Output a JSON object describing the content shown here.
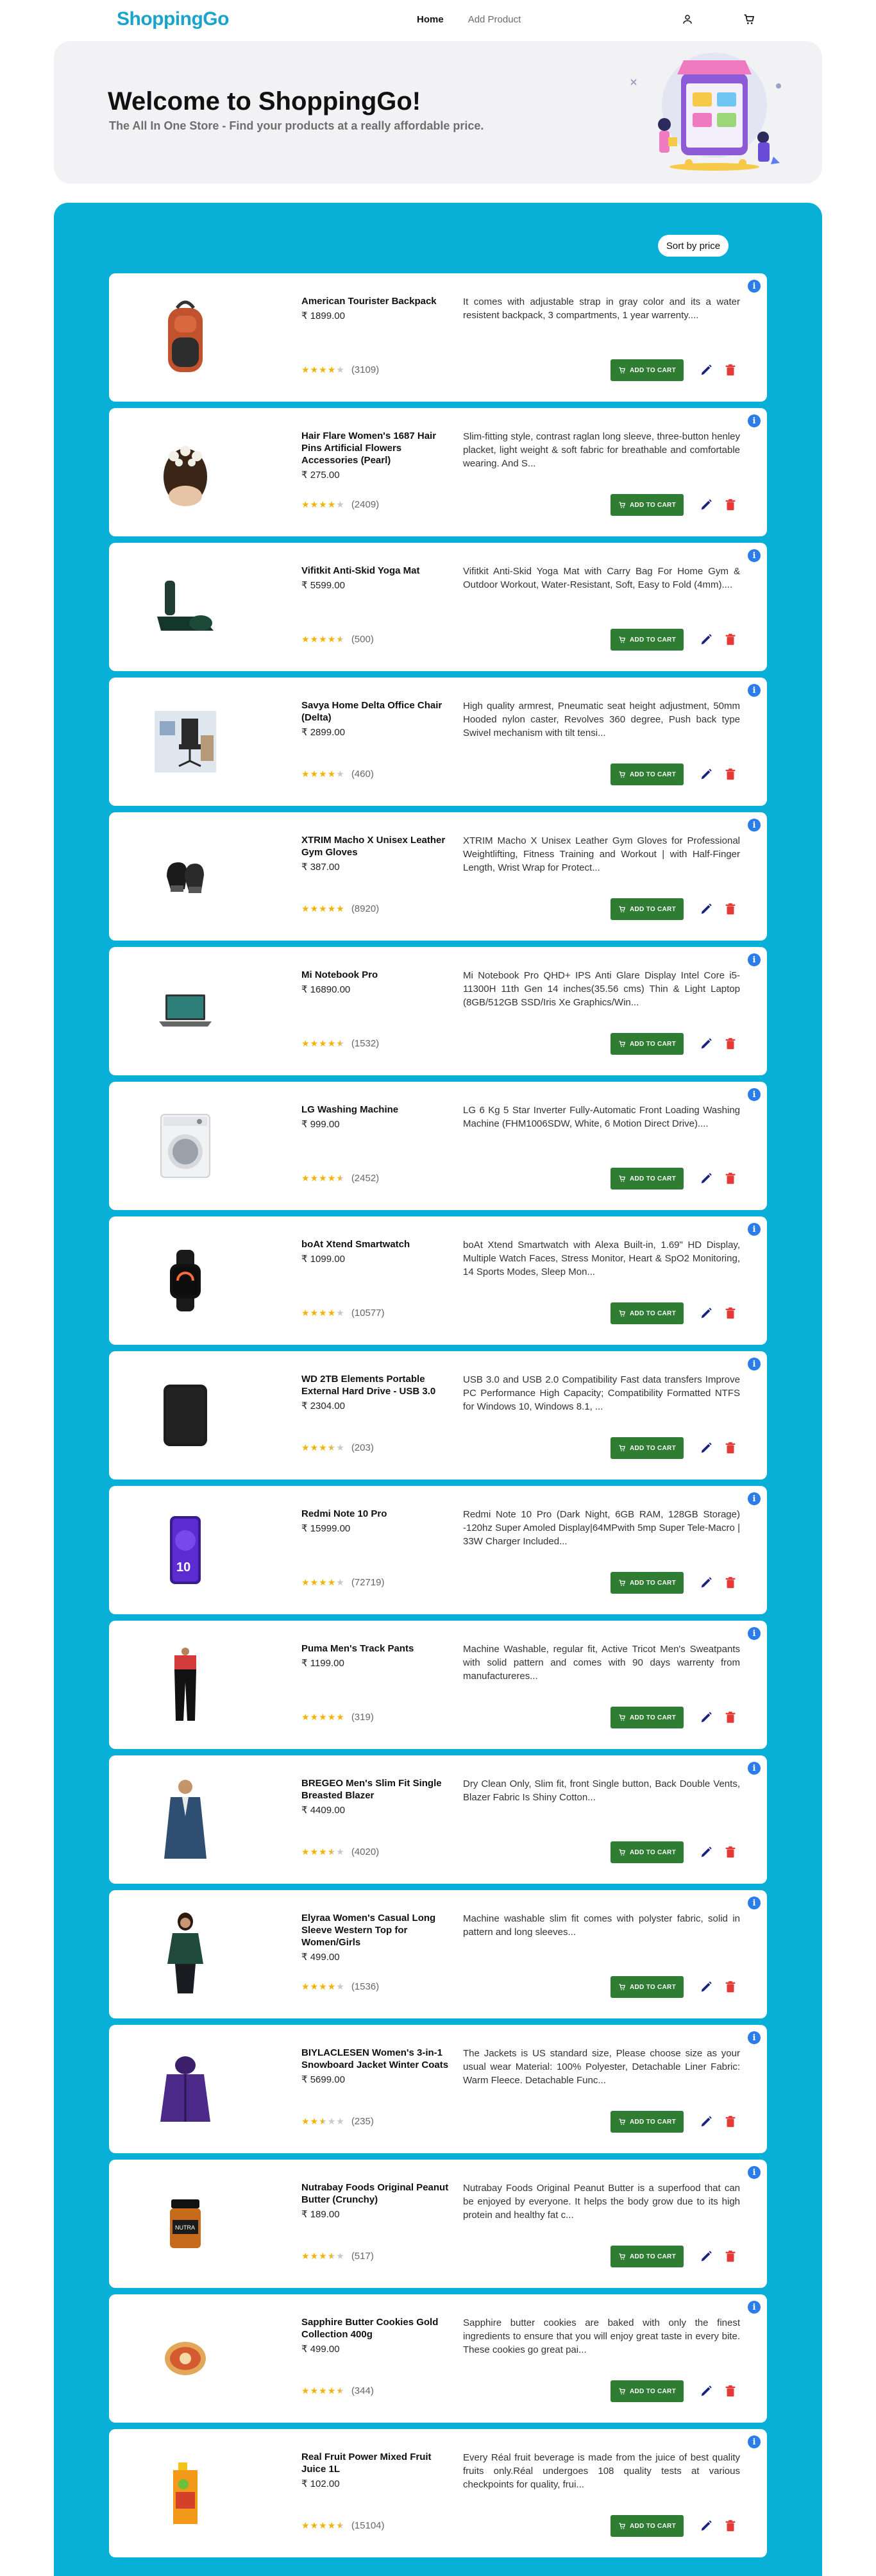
{
  "brand": "ShoppingGo",
  "nav": {
    "home": "Home",
    "add_product": "Add Product",
    "icons": [
      "user-icon",
      "cart-icon"
    ]
  },
  "hero": {
    "title": "Welcome to ShoppingGo!",
    "subtitle": "The All In One Store - Find your products at a really affordable price."
  },
  "sort_label": "Sort by price",
  "actions": {
    "add_to_cart": "ADD TO CART"
  },
  "colors": {
    "brand": "#1aa3cc",
    "panel": "#08afd6",
    "cart_button": "#2e7d32",
    "delete": "#e53935",
    "edit": "#1a237e",
    "info": "#2b7de9",
    "star": "#f5b301"
  },
  "products": [
    {
      "title": "American Tourister Backpack",
      "price": "₹ 1899.00",
      "desc": "It comes with adjustable strap in gray color and its a water resistent backpack, 3 compartments, 1 year warrenty....",
      "rating": 4,
      "count": "(3109)",
      "icon": "backpack"
    },
    {
      "title": "Hair Flare Women's 1687 Hair Pins Artificial Flowers Accessories (Pearl)",
      "price": "₹ 275.00",
      "desc": "Slim-fitting style, contrast raglan long sleeve, three-button henley placket, light weight & soft fabric for breathable and comfortable wearing. And S...",
      "rating": 4,
      "count": "(2409)",
      "icon": "hairpin"
    },
    {
      "title": "Vifitkit Anti-Skid Yoga Mat",
      "price": "₹ 5599.00",
      "desc": "Vifitkit Anti-Skid Yoga Mat with Carry Bag For Home Gym & Outdoor Workout, Water-Resistant, Soft, Easy to Fold (4mm)....",
      "rating": 4.5,
      "count": "(500)",
      "icon": "yoga-mat"
    },
    {
      "title": "Savya Home Delta Office Chair (Delta)",
      "price": "₹ 2899.00",
      "desc": "High quality armrest, Pneumatic seat height adjustment, 50mm Hooded nylon caster, Revolves 360 degree, Push back type Swivel mechanism with tilt tensi...",
      "rating": 4,
      "count": "(460)",
      "icon": "chair"
    },
    {
      "title": "XTRIM Macho X Unisex Leather Gym Gloves",
      "price": "₹ 387.00",
      "desc": "XTRIM Macho X Unisex Leather Gym Gloves for Professional Weightlifting, Fitness Training and Workout | with Half-Finger Length, Wrist Wrap for Protect...",
      "rating": 5,
      "count": "(8920)",
      "icon": "gloves"
    },
    {
      "title": "Mi Notebook Pro",
      "price": "₹ 16890.00",
      "desc": "Mi Notebook Pro QHD+ IPS Anti Glare Display Intel Core i5-11300H 11th Gen 14 inches(35.56 cms) Thin & Light Laptop (8GB/512GB SSD/Iris Xe Graphics/Win...",
      "rating": 4.5,
      "count": "(1532)",
      "icon": "laptop"
    },
    {
      "title": "LG Washing Machine",
      "price": "₹ 999.00",
      "desc": "LG 6 Kg 5 Star Inverter Fully-Automatic Front Loading Washing Machine (FHM1006SDW, White, 6 Motion Direct Drive)....",
      "rating": 4.5,
      "count": "(2452)",
      "icon": "washing-machine"
    },
    {
      "title": "boAt Xtend Smartwatch",
      "price": "₹ 1099.00",
      "desc": "boAt Xtend Smartwatch with Alexa Built-in, 1.69\" HD Display, Multiple Watch Faces, Stress Monitor, Heart & SpO2 Monitoring, 14 Sports Modes, Sleep Mon...",
      "rating": 4,
      "count": "(10577)",
      "icon": "smartwatch"
    },
    {
      "title": "WD 2TB Elements Portable External Hard Drive - USB 3.0",
      "price": "₹ 2304.00",
      "desc": "USB 3.0 and USB 2.0 Compatibility Fast data transfers Improve PC Performance High Capacity; Compatibility Formatted NTFS for Windows 10, Windows 8.1, ...",
      "rating": 3.5,
      "count": "(203)",
      "icon": "hard-drive"
    },
    {
      "title": "Redmi Note 10 Pro",
      "price": "₹ 15999.00",
      "desc": "Redmi Note 10 Pro (Dark Night, 6GB RAM, 128GB Storage) -120hz Super Amoled Display|64MPwith 5mp Super Tele-Macro | 33W Charger Included...",
      "rating": 4,
      "count": "(72719)",
      "icon": "phone"
    },
    {
      "title": "Puma Men's Track Pants",
      "price": "₹ 1199.00",
      "desc": "Machine Washable, regular fit, Active Tricot Men's Sweatpants with solid pattern and comes with 90 days warrenty from manufactureres...",
      "rating": 5,
      "count": "(319)",
      "icon": "track-pants"
    },
    {
      "title": "BREGEO Men's Slim Fit Single Breasted Blazer",
      "price": "₹ 4409.00",
      "desc": "Dry Clean Only, Slim fit, front Single button, Back Double Vents, Blazer Fabric Is Shiny Cotton...",
      "rating": 3.5,
      "count": "(4020)",
      "icon": "blazer"
    },
    {
      "title": "Elyraa Women's Casual Long Sleeve Western Top for Women/Girls",
      "price": "₹ 499.00",
      "desc": "Machine washable slim fit comes with polyster fabric, solid in pattern and long sleeves...",
      "rating": 4,
      "count": "(1536)",
      "icon": "top"
    },
    {
      "title": "BIYLACLESEN Women's 3-in-1 Snowboard Jacket Winter Coats",
      "price": "₹ 5699.00",
      "desc": "The Jackets is US standard size, Please choose size as your usual wear Material: 100% Polyester, Detachable Liner Fabric: Warm Fleece. Detachable Func...",
      "rating": 2.5,
      "count": "(235)",
      "icon": "jacket"
    },
    {
      "title": "Nutrabay Foods Original Peanut Butter (Crunchy)",
      "price": "₹ 189.00",
      "desc": "Nutrabay Foods Original Peanut Butter is a superfood that can be enjoyed by everyone. It helps the body grow due to its high protein and healthy fat c...",
      "rating": 3.5,
      "count": "(517)",
      "icon": "peanut-butter"
    },
    {
      "title": "Sapphire Butter Cookies Gold Collection 400g",
      "price": "₹ 499.00",
      "desc": "Sapphire butter cookies are baked with only the finest ingredients to ensure that you will enjoy great taste in every bite. These cookies go great pai...",
      "rating": 4.5,
      "count": "(344)",
      "icon": "cookies"
    },
    {
      "title": "Real Fruit Power Mixed Fruit Juice 1L",
      "price": "₹ 102.00",
      "desc": "Every Réal fruit beverage is made from the juice of best quality fruits only.Réal undergoes 108 quality tests at various checkpoints for quality, frui...",
      "rating": 4.5,
      "count": "(15104)",
      "icon": "juice"
    }
  ]
}
